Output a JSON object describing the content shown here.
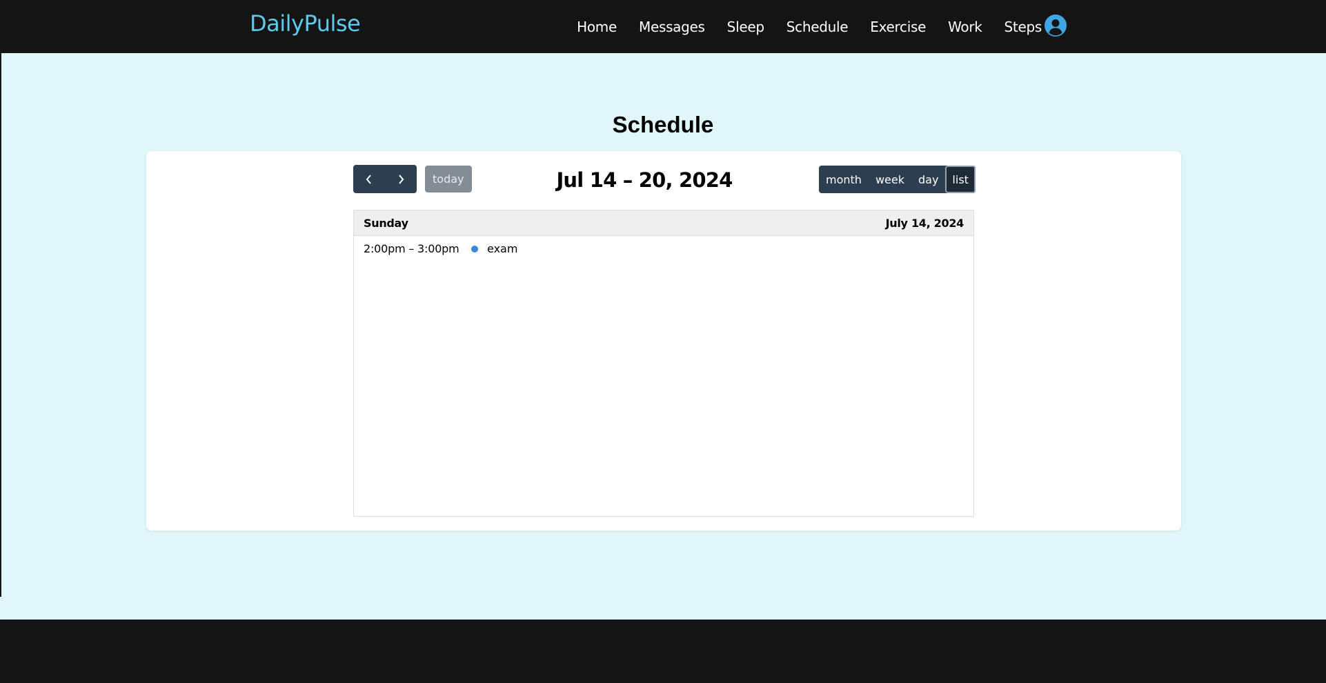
{
  "brand": "DailyPulse",
  "nav": {
    "links": [
      "Home",
      "Messages",
      "Sleep",
      "Schedule",
      "Exercise",
      "Work",
      "Steps"
    ],
    "avatar_icon": "user-circle-icon",
    "avatar_color": "#3ea6e0"
  },
  "page": {
    "title": "Schedule"
  },
  "calendar": {
    "prev_icon": "chevron-left-icon",
    "next_icon": "chevron-right-icon",
    "today_label": "today",
    "range_title": "Jul 14 – 20, 2024",
    "views": [
      "month",
      "week",
      "day",
      "list"
    ],
    "active_view": "list",
    "days": [
      {
        "weekday": "Sunday",
        "date": "July 14, 2024",
        "events": [
          {
            "time": "2:00pm – 3:00pm",
            "title": "exam",
            "color": "#3788d8"
          }
        ]
      }
    ]
  },
  "colors": {
    "brand": "#5ccbf0",
    "navbar_bg": "#141414",
    "page_bg": "#e0f6f8",
    "button_bg": "#2c3e50"
  }
}
